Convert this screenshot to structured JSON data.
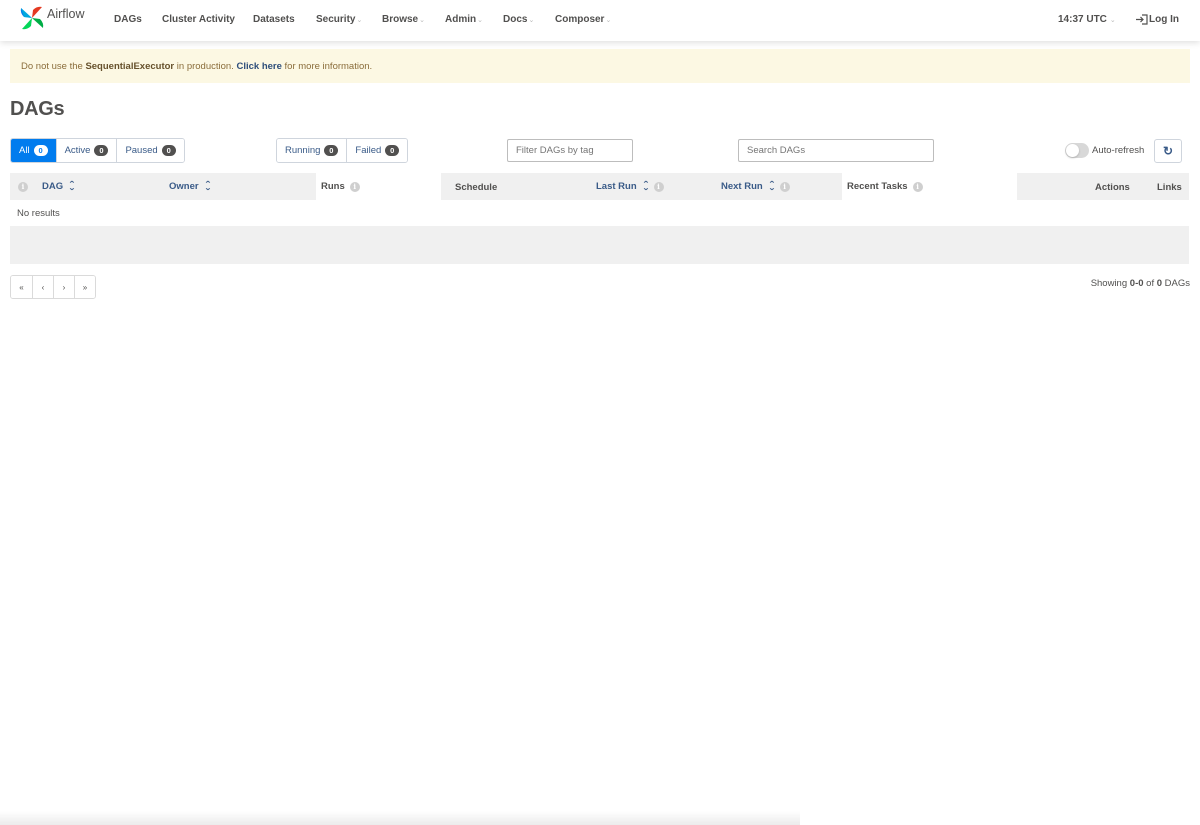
{
  "navbar": {
    "brand": "Airflow",
    "items": [
      {
        "label": "DAGs",
        "dropdown": false
      },
      {
        "label": "Cluster Activity",
        "dropdown": false
      },
      {
        "label": "Datasets",
        "dropdown": false
      },
      {
        "label": "Security",
        "dropdown": true
      },
      {
        "label": "Browse",
        "dropdown": true
      },
      {
        "label": "Admin",
        "dropdown": true
      },
      {
        "label": "Docs",
        "dropdown": true
      },
      {
        "label": "Composer",
        "dropdown": true
      }
    ],
    "time": "14:37 UTC",
    "login": "Log In"
  },
  "alert": {
    "prefix": "Do not use the ",
    "executor": "SequentialExecutor",
    "middle": " in production. ",
    "link": "Click here",
    "suffix": " for more information."
  },
  "page_title": "DAGs",
  "status_filter": [
    {
      "label": "All",
      "count": "0",
      "active": true
    },
    {
      "label": "Active",
      "count": "0",
      "active": false
    },
    {
      "label": "Paused",
      "count": "0",
      "active": false
    }
  ],
  "run_filter": [
    {
      "label": "Running",
      "count": "0"
    },
    {
      "label": "Failed",
      "count": "0"
    }
  ],
  "tag_filter": {
    "placeholder": "Filter DAGs by tag"
  },
  "search": {
    "placeholder": "Search DAGs"
  },
  "auto_refresh": {
    "label": "Auto-refresh",
    "enabled": false
  },
  "table": {
    "columns": [
      "DAG",
      "Owner",
      "Runs",
      "Schedule",
      "Last Run",
      "Next Run",
      "Recent Tasks",
      "Actions",
      "Links"
    ],
    "empty_text": "No results"
  },
  "pagination": [
    "«",
    "‹",
    "›",
    "»"
  ],
  "showing": {
    "prefix": "Showing ",
    "range": "0-0",
    "middle": " of ",
    "total": "0",
    "suffix": " DAGs"
  },
  "colors": {
    "accent": "#017cee",
    "link": "#3a5b88",
    "alert_bg": "#fcf8e3"
  }
}
